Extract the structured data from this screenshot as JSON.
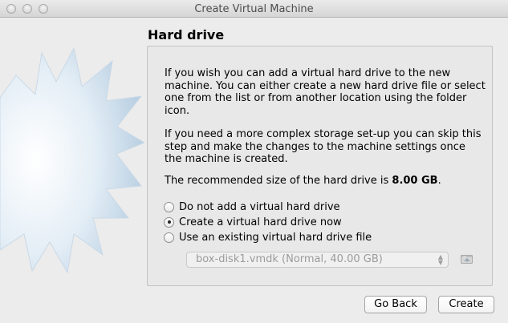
{
  "window": {
    "title": "Create Virtual Machine"
  },
  "page": {
    "heading": "Hard drive",
    "para1": "If you wish you can add a virtual hard drive to the new machine. You can either create a new hard drive file or select one from the list or from another location using the folder icon.",
    "para2": "If you need a more complex storage set-up you can skip this step and make the changes to the machine settings once the machine is created.",
    "para3_prefix": "The recommended size of the hard drive is ",
    "para3_size": "8.00 GB",
    "para3_suffix": "."
  },
  "options": [
    {
      "label": "Do not add a virtual hard drive",
      "checked": false
    },
    {
      "label": "Create a virtual hard drive now",
      "checked": true
    },
    {
      "label": "Use an existing virtual hard drive file",
      "checked": false
    }
  ],
  "disk_select": {
    "value": "box-disk1.vmdk (Normal, 40.00 GB)",
    "enabled": false
  },
  "buttons": {
    "back": "Go Back",
    "create": "Create"
  },
  "icons": {
    "folder": "folder-open-icon",
    "select_arrows": "updown-arrows-icon"
  }
}
